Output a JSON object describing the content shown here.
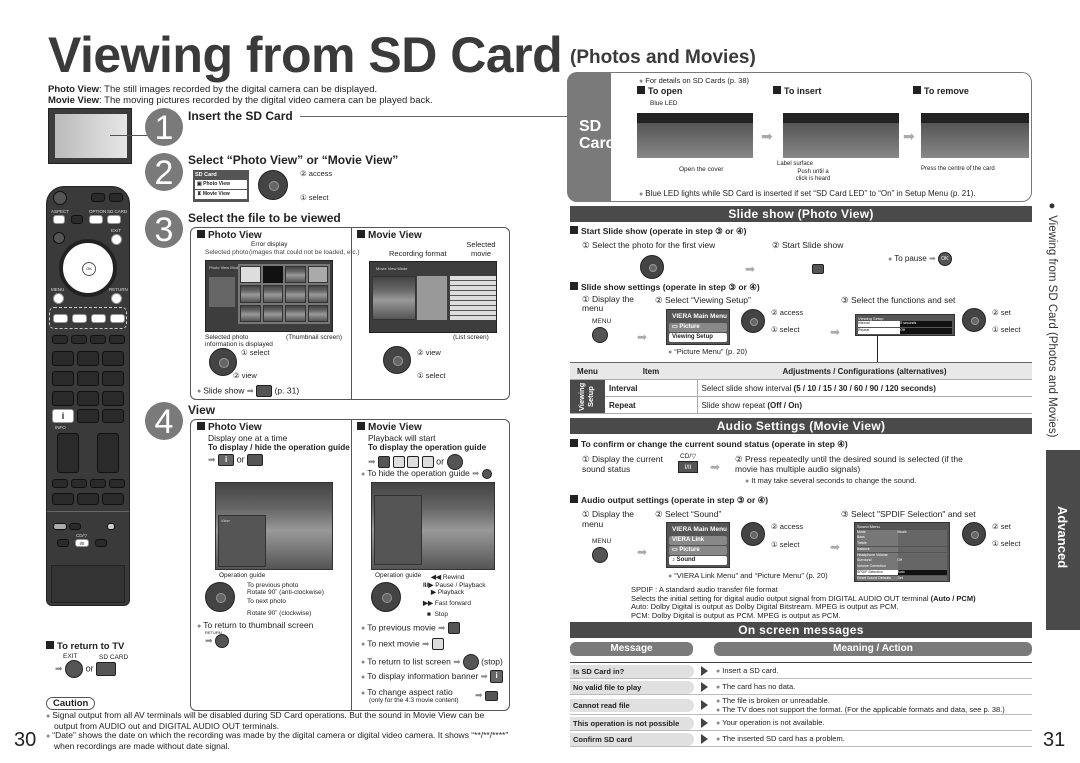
{
  "page": {
    "title": "Viewing from SD Card",
    "subtitle": "(Photos and Movies)",
    "left_page_number": "30",
    "right_page_number": "31",
    "side_running_head": "● Viewing from SD Card (Photos and Movies)",
    "side_tab": "Advanced"
  },
  "intro": {
    "photo_view_term": "Photo View",
    "photo_view_desc": ": The still images recorded by the digital camera can be displayed.",
    "movie_view_term": "Movie View",
    "movie_view_desc": ": The moving pictures recorded by the digital video camera can be played back."
  },
  "steps": [
    {
      "number": "1",
      "heading": "Insert the SD Card"
    },
    {
      "number": "2",
      "heading": "Select “Photo View” or “Movie View”"
    },
    {
      "number": "3",
      "heading": "Select the file to be viewed"
    },
    {
      "number": "4",
      "heading": "View"
    }
  ],
  "step2": {
    "menu_title": "SD Card",
    "menu_items": [
      "Photo View",
      "Movie View"
    ],
    "access_label": "② access",
    "select_label": "① select"
  },
  "step3": {
    "photo": {
      "heading": "Photo View",
      "error_display": "Error display",
      "selected_photo": "Selected photo",
      "error_note": "(images that could not be loaded, etc.)",
      "screen_title": "Photo View Mode",
      "info_caption": "Selected photo information is displayed",
      "screen_caption": "(Thumbnail screen)",
      "select_label": "① select",
      "view_label": "② view",
      "slideshow": "Slide show",
      "slideshow_btn": "R",
      "slideshow_page": "(p. 31)"
    },
    "movie": {
      "heading": "Movie View",
      "recording_format": "Recording format",
      "selected_movie": "Selected movie",
      "screen_title": "Movie View Mode",
      "screen_caption": "(List screen)",
      "view_label": "② view",
      "select_label": "① select"
    }
  },
  "step4": {
    "photo": {
      "heading": "Photo View",
      "line1": "Display one at a time",
      "line2": "To display / hide the operation guide",
      "info_label": "INFO",
      "or": "or",
      "option_label": "OPTION",
      "guide_caption": "Operation guide",
      "guide_title": "View",
      "guide_items": [
        "Rotate",
        "EXIT",
        "Select",
        "List",
        "Rotate",
        "Slide show"
      ],
      "controls": [
        "To previous photo",
        "Rotate 90˚ (anti-clockwise)",
        "To next photo",
        "Rotate 90˚ (clockwise)"
      ],
      "return_thumb": "To return to thumbnail screen",
      "return_label": "RETURN"
    },
    "movie": {
      "heading": "Movie View",
      "line1": "Playback will start",
      "line2": "To display the operation guide",
      "color_btns": [
        "R",
        "G",
        "Y",
        "B"
      ],
      "or": "or",
      "hide_guide": "To hide the operation guide",
      "return_label": "RETURN",
      "guide_caption": "Operation guide",
      "guide_items": [
        "Pause",
        "EXIT",
        "Search",
        "RETURN",
        "Stop",
        "Skip"
      ],
      "controls": [
        {
          "sym": "◀◀",
          "label": "Rewind"
        },
        {
          "sym": "II/▶",
          "label": "Pause / Playback"
        },
        {
          "sym": "▶",
          "label": "Playback"
        },
        {
          "sym": "▶▶",
          "label": "Fast forward"
        },
        {
          "sym": "■",
          "label": "Stop"
        }
      ],
      "actions": [
        {
          "text": "To previous movie",
          "btn": "R"
        },
        {
          "text": "To next movie",
          "btn": "G"
        },
        {
          "text": "To return to list screen",
          "suffix": "(stop)"
        },
        {
          "text": "To display information banner",
          "btn": "INFO"
        },
        {
          "text": "To change aspect ratio",
          "note": "(only for the 4:3 movie content)",
          "btn": "ASPECT"
        }
      ]
    }
  },
  "return_tv": {
    "heading": "To return to TV",
    "exit_label": "EXIT",
    "or": "or",
    "sdcard_label": "SD CARD"
  },
  "caution": {
    "title": "Caution",
    "items": [
      "Signal output from all AV terminals will be disabled during SD Card operations. But the sound in Movie View can be output from AUDIO out and DIGITAL AUDIO OUT terminals.",
      "“Date” shows the date on which the recording was made by the digital camera or digital video camera. It shows “**/**/****” when recordings are made without date signal."
    ]
  },
  "remote": {
    "labels": [
      "ASPECT",
      "OPTION",
      "SD CARD",
      "EXIT",
      "OK",
      "MENU",
      "RETURN",
      "R",
      "G",
      "Y",
      "B",
      "INFO",
      "CD/▽",
      "I/II"
    ]
  },
  "sdcard": {
    "side_label": "SD Card",
    "details": "For details on SD Cards (p. 38)",
    "to_open": "To open",
    "to_insert": "To insert",
    "to_remove": "To remove",
    "blue_led": "Blue LED",
    "open_cover": "Open the cover",
    "label_surface": "Label surface",
    "push_until": "Push until a click is heard",
    "press_centre": "Press the centre of the card",
    "led_note": "Blue LED lights while SD Card is inserted if set “SD Card LED” to “On” in Setup Menu (p. 21)."
  },
  "slideshow": {
    "bar": "Slide show (Photo View)",
    "start_heading": "Start Slide show (operate in step ③ or ④)",
    "start_step1": "① Select the photo for the first view",
    "start_step2": "② Start Slide show",
    "start_btn": "R",
    "pause": "To pause",
    "pause_btn": "OK",
    "settings_heading": "Slide show settings (operate in step ③ or ④)",
    "s1": "① Display the menu",
    "menu_label": "MENU",
    "s2": "② Select “Viewing Setup”",
    "main_menu": "VIERA Main Menu",
    "menu_items": [
      "Picture",
      "Viewing Setup"
    ],
    "access": "② access",
    "select": "① select",
    "picture_menu_ref": "“Picture Menu” (p. 20)",
    "s3": "③ Select the functions and set",
    "setup_title": "Viewing Setup",
    "setup_rows": [
      {
        "k": "Interval",
        "v": "5 seconds"
      },
      {
        "k": "Repeat",
        "v": "Off"
      }
    ],
    "set": "② set",
    "select2": "① select"
  },
  "setup_table": {
    "headers": [
      "Menu",
      "Item",
      "Adjustments / Configurations (alternatives)"
    ],
    "menu_name": "Viewing Setup",
    "rows": [
      {
        "item": "Interval",
        "desc": "Select slide show interval ",
        "bold": "(5 / 10 / 15 / 30 / 60 / 90 / 120 seconds)"
      },
      {
        "item": "Repeat",
        "desc": "Slide show repeat ",
        "bold": "(Off / On)"
      }
    ]
  },
  "audio": {
    "bar": "Audio Settings (Movie View)",
    "confirm_heading": "To confirm or change the current sound status (operate in step ④)",
    "c1": "① Display the current sound status",
    "c1_btn_top": "CD/▽",
    "c1_btn": "I/II",
    "c2": "② Press repeatedly until the desired sound is selected (if the movie has multiple audio signals)",
    "c2_note": "It may take several seconds to change the sound.",
    "output_heading": "Audio output settings (operate in step ③ or ④)",
    "o1": "① Display the menu",
    "menu_label": "MENU",
    "o2": "② Select “Sound”",
    "main_menu": "VIERA Main Menu",
    "menu_items": [
      "VIERA Link",
      "Picture",
      "Sound"
    ],
    "access": "② access",
    "select": "① select",
    "menu_ref": "“VIERA Link Menu” and “Picture Menu” (p. 20)",
    "o3": "③ Select \"SPDIF Selection\" and set",
    "sound_menu_title": "Sound Menu",
    "sound_rows": [
      {
        "k": "Mode",
        "v": "Music"
      },
      {
        "k": "Bass",
        "v": ""
      },
      {
        "k": "Treble",
        "v": ""
      },
      {
        "k": "Balance",
        "v": ""
      },
      {
        "k": "Headphone Volume",
        "v": ""
      },
      {
        "k": "Surround",
        "v": "Off"
      },
      {
        "k": "Volume Correction",
        "v": ""
      },
      {
        "k": "SPDIF Selection",
        "v": "Auto"
      },
      {
        "k": "Reset Sound Defaults",
        "v": "Set"
      }
    ],
    "set": "② set",
    "select2": "① select",
    "spdif_def": "SPDIF : A standard audio transfer file format",
    "spdif_line": "Selects the initial setting for digital audio output signal from DIGITAL AUDIO OUT terminal ",
    "spdif_opts": "(Auto / PCM)",
    "auto_line": "Auto: Dolby Digital is output as Dolby Digital Bitstream. MPEG is output as PCM.",
    "pcm_line": "PCM: Dolby Digital is output as PCM. MPEG is output as PCM."
  },
  "messages": {
    "bar": "On screen messages",
    "col_message": "Message",
    "col_meaning": "Meaning / Action",
    "rows": [
      {
        "msg": "Is SD Card in?",
        "lines": [
          "Insert a SD card."
        ]
      },
      {
        "msg": "No valid file to play",
        "lines": [
          "The card has no data."
        ]
      },
      {
        "msg": "Cannot read file",
        "lines": [
          "The file is broken or unreadable.",
          "The TV does not support the format. (For the applicable formats and data, see p. 38.)"
        ]
      },
      {
        "msg": "This operation is not possible",
        "lines": [
          "Your operation is not available."
        ]
      },
      {
        "msg": "Confirm SD card",
        "lines": [
          "The inserted SD card has a problem."
        ]
      }
    ]
  }
}
